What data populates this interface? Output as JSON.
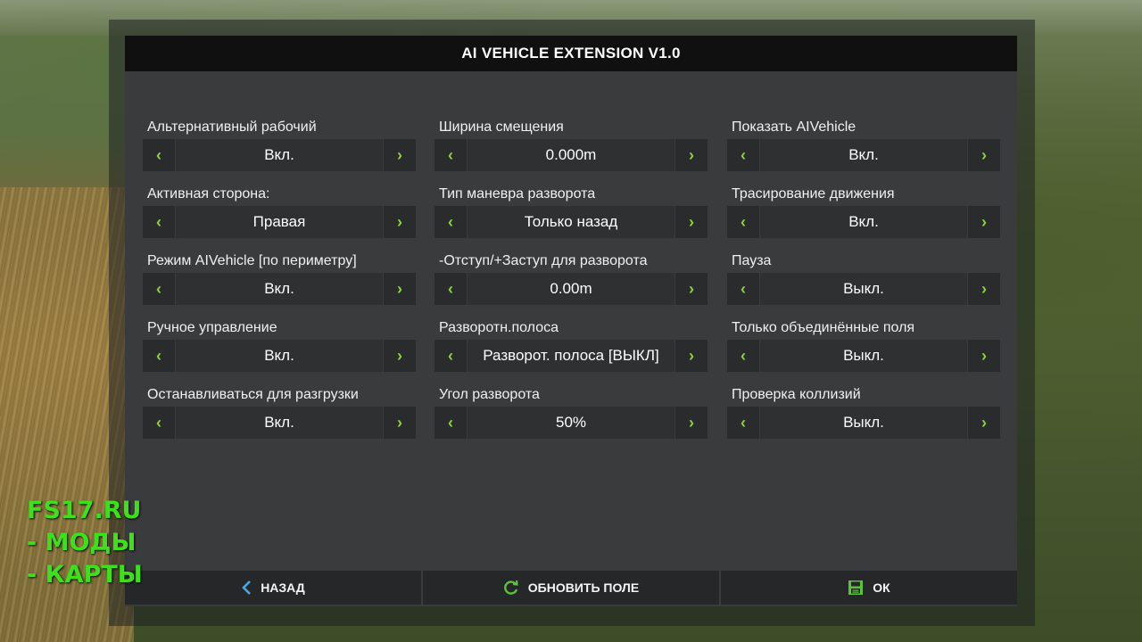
{
  "window": {
    "title": "AI VEHICLE EXTENSION V1.0"
  },
  "columns": [
    {
      "settings": [
        {
          "label": "Альтернативный рабочий",
          "value": "Вкл."
        },
        {
          "label": "Активная сторона:",
          "value": "Правая"
        },
        {
          "label": "Режим AIVehicle [по периметру]",
          "value": "Вкл."
        },
        {
          "label": "Ручное управление",
          "value": "Вкл."
        },
        {
          "label": "Останавливаться для разгрузки",
          "value": "Вкл."
        }
      ]
    },
    {
      "settings": [
        {
          "label": "Ширина смещения",
          "value": "0.000m"
        },
        {
          "label": "Тип маневра разворота",
          "value": "Только назад"
        },
        {
          "label": "-Отступ/+Заступ для разворота",
          "value": "0.00m"
        },
        {
          "label": "Разворотн.полоса",
          "value": "Разворот. полоса [ВЫКЛ]"
        },
        {
          "label": "Угол разворота",
          "value": "50%"
        }
      ]
    },
    {
      "settings": [
        {
          "label": "Показать AIVehicle",
          "value": "Вкл."
        },
        {
          "label": "Трасирование движения",
          "value": "Вкл."
        },
        {
          "label": "Пауза",
          "value": "Выкл."
        },
        {
          "label": "Только объединённые поля",
          "value": "Выкл."
        },
        {
          "label": "Проверка коллизий",
          "value": "Выкл."
        }
      ]
    }
  ],
  "arrows": {
    "left": "‹",
    "right": "›"
  },
  "footer": {
    "back_label": "НАЗАД",
    "refresh_label": "ОБНОВИТЬ ПОЛЕ",
    "ok_label": "ОК"
  },
  "watermark": {
    "line1": "FS17.RU",
    "line2": "- МОДЫ",
    "line3": "- КАРТЫ"
  },
  "colors": {
    "accent": "#8bd33a",
    "header_bg": "#101010",
    "panel_bg": "#3a3b3d",
    "watermark": "#3ee01c"
  }
}
